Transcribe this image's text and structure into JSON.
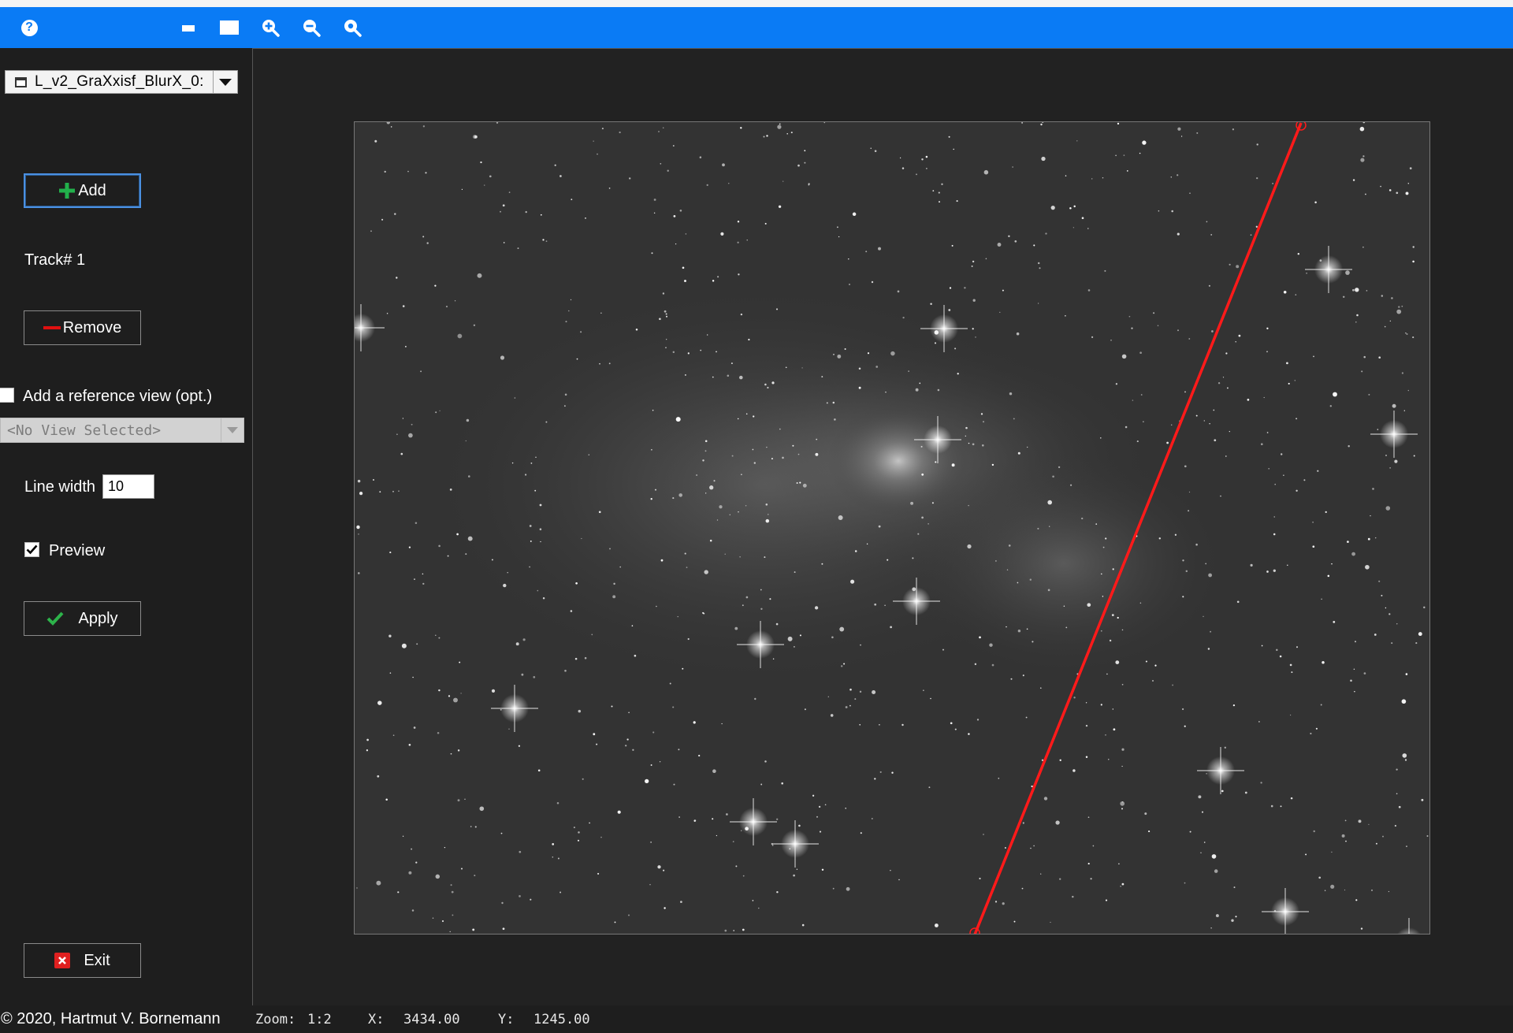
{
  "toolbar": {
    "help_label": "?",
    "buttons": [
      {
        "name": "minimize-view-icon"
      },
      {
        "name": "maximize-view-icon"
      },
      {
        "name": "zoom-in-icon"
      },
      {
        "name": "zoom-out-icon"
      },
      {
        "name": "zoom-fit-icon"
      }
    ],
    "accent_color": "#0a7bf5"
  },
  "sidebar": {
    "view_selector": {
      "value": "L_v2_GraXxisf_BlurX_0:"
    },
    "add_button": "Add",
    "track_label": "Track# 1",
    "remove_button": "Remove",
    "reference_checkbox": {
      "label": "Add a reference view (opt.)",
      "checked": false
    },
    "reference_select": {
      "value": "<No View Selected>"
    },
    "line_width": {
      "label": "Line width",
      "value": "10"
    },
    "preview": {
      "label": "Preview",
      "checked": true
    },
    "apply_button": "Apply",
    "exit_button": "Exit"
  },
  "viewport": {
    "track_line_color": "#ff1a1a"
  },
  "status": {
    "copyright": "© 2020, Hartmut V. Bornemann",
    "zoom_label": "Zoom:",
    "zoom_value": "1:2",
    "x_label": "X:",
    "x_value": "3434.00",
    "y_label": "Y:",
    "y_value": "1245.00"
  }
}
